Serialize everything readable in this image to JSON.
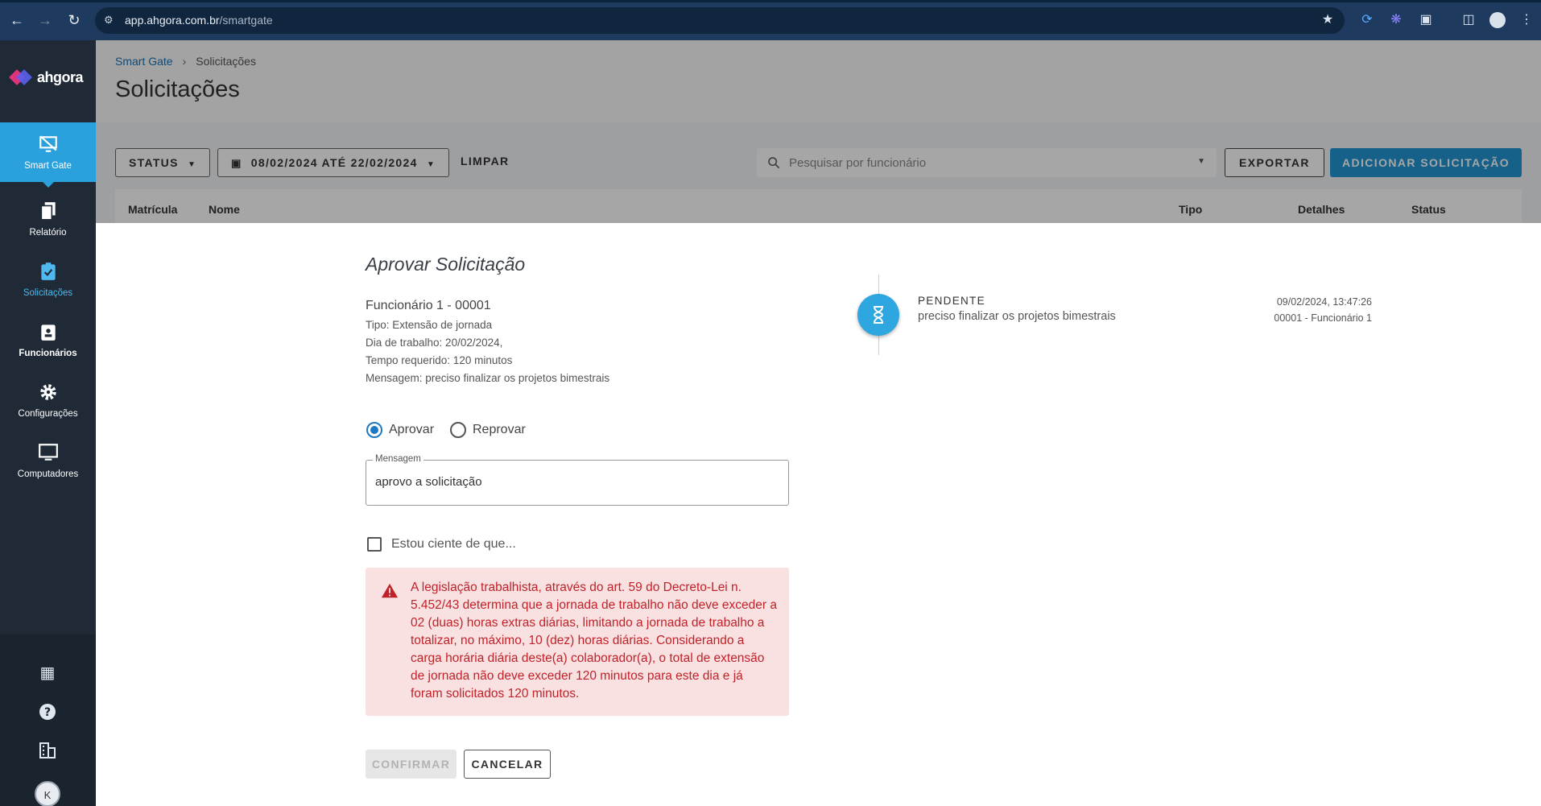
{
  "browser": {
    "url_host": "app.ahgora.com.br",
    "url_path": "/smartgate"
  },
  "sidebar": {
    "logo_text": "ahgora",
    "items": [
      {
        "label": "Smart Gate",
        "icon": "monitor-off-icon"
      },
      {
        "label": "Relatório",
        "icon": "file-copy-icon"
      },
      {
        "label": "Solicitações",
        "icon": "clipboard-check-icon"
      },
      {
        "label": "Funcionários",
        "icon": "badge-icon"
      },
      {
        "label": "Configurações",
        "icon": "gear-icon"
      },
      {
        "label": "Computadores",
        "icon": "desktop-icon"
      }
    ],
    "avatar_initial": "K"
  },
  "header": {
    "breadcrumb": [
      "Smart Gate",
      "Solicitações"
    ],
    "title": "Solicitações"
  },
  "toolbar": {
    "status_label": "STATUS",
    "date_start": "08/02/2024",
    "date_sep": "ATÉ",
    "date_end": "22/02/2024",
    "clear_label": "LIMPAR",
    "search_placeholder": "Pesquisar por funcionário",
    "export_label": "EXPORTAR",
    "add_label": "ADICIONAR SOLICITAÇÃO"
  },
  "table": {
    "columns": [
      "Matrícula",
      "Nome",
      "Tipo",
      "Detalhes",
      "Status"
    ]
  },
  "modal": {
    "title": "Aprovar Solicitação",
    "employee": "Funcionário 1 - 00001",
    "details": [
      "Tipo: Extensão de jornada",
      "Dia de trabalho: 20/02/2024,",
      "Tempo requerido: 120 minutos",
      "Mensagem: preciso finalizar os projetos bimestrais"
    ],
    "approve_label": "Aprovar",
    "reject_label": "Reprovar",
    "message_label": "Mensagem",
    "message_value": "aprovo a solicitação",
    "checkbox_label": "Estou ciente de que...",
    "alert_text": "A legislação trabalhista, através do art. 59 do Decreto-Lei n. 5.452/43 determina que a jornada de trabalho não deve exceder a 02 (duas) horas extras diárias, limitando a jornada de trabalho a totalizar, no máximo, 10 (dez) horas diárias. Considerando a carga horária diária deste(a) colaborador(a), o total de extensão de jornada não deve exceder 120 minutos para este dia e já foram solicitados 120 minutos.",
    "confirm_label": "CONFIRMAR",
    "cancel_label": "CANCELAR",
    "timeline": {
      "status": "PENDENTE",
      "message": "preciso finalizar os projetos bimestrais",
      "datetime": "09/02/2024, 13:47:26",
      "user": "00001 - Funcionário 1"
    }
  },
  "colors": {
    "accent": "#2196d3",
    "sidebar_bg": "#1f2a36",
    "alert_bg": "#f9e1e1",
    "alert_text": "#c0222a"
  }
}
